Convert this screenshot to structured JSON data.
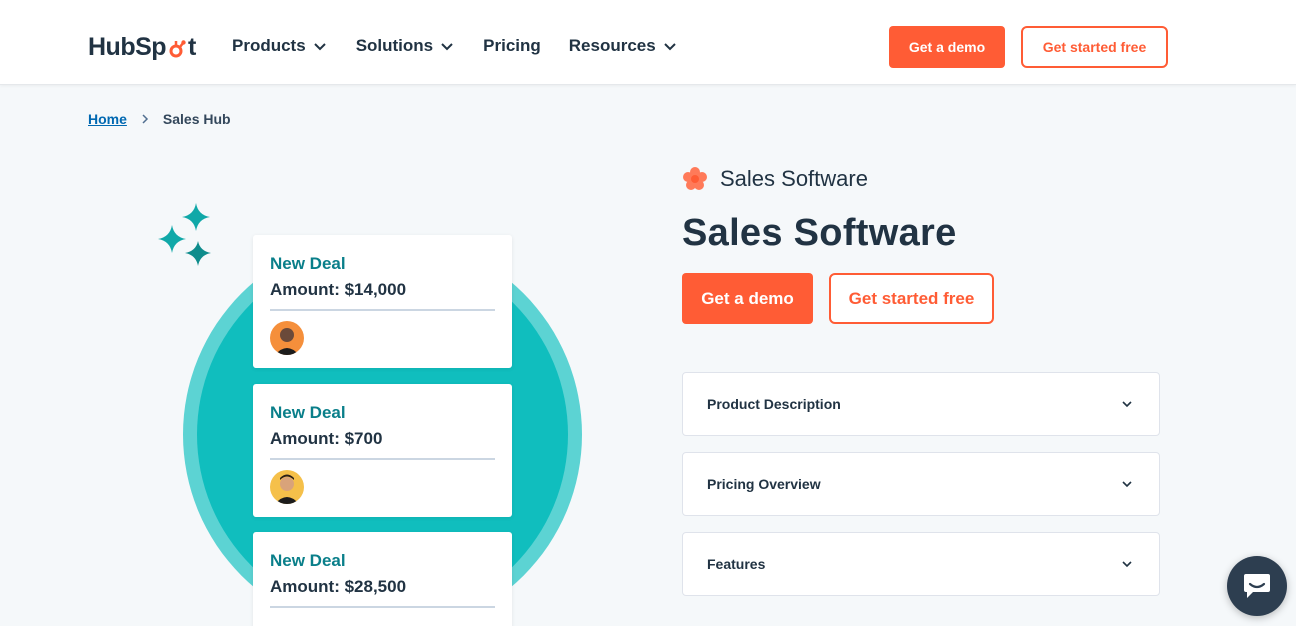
{
  "header": {
    "logo": {
      "text_start": "HubSp",
      "text_end": "t",
      "brand_color": "#ff5c35"
    },
    "nav": [
      {
        "label": "Products",
        "has_dropdown": true
      },
      {
        "label": "Solutions",
        "has_dropdown": true
      },
      {
        "label": "Pricing",
        "has_dropdown": false
      },
      {
        "label": "Resources",
        "has_dropdown": true
      }
    ],
    "demo_button": "Get a demo",
    "free_button": "Get started free"
  },
  "breadcrumb": {
    "home": "Home",
    "current": "Sales Hub"
  },
  "illustration": {
    "deals": [
      {
        "title": "New Deal",
        "amount": "Amount: $14,000",
        "avatar_color": "#f58f3b"
      },
      {
        "title": "New Deal",
        "amount": "Amount: $700",
        "avatar_color": "#f5c04a"
      },
      {
        "title": "New Deal",
        "amount": "Amount: $28,500"
      }
    ],
    "colors": {
      "circle_outer": "#5cd3d3",
      "circle_inner": "#10bebe",
      "sparkle": "#10a8a8"
    }
  },
  "main": {
    "eyebrow": "Sales Software",
    "title": "Sales Software",
    "demo_button": "Get a demo",
    "free_button": "Get started free",
    "accordions": [
      {
        "label": "Product Description"
      },
      {
        "label": "Pricing Overview"
      },
      {
        "label": "Features"
      }
    ]
  },
  "colors": {
    "accent": "#ff5c35",
    "text": "#213343",
    "link": "#0068b1",
    "background": "#f5f8fa"
  }
}
